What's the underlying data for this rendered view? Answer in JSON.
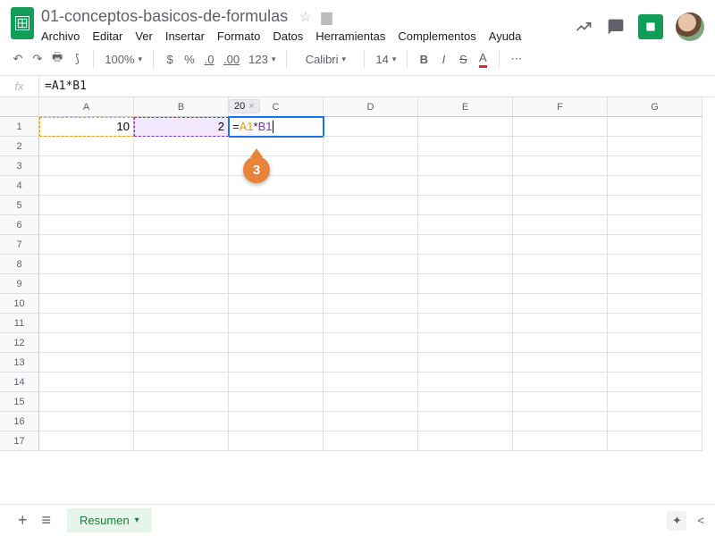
{
  "doc": {
    "title": "01-conceptos-basicos-de-formulas"
  },
  "menus": {
    "archivo": "Archivo",
    "editar": "Editar",
    "ver": "Ver",
    "insertar": "Insertar",
    "formato": "Formato",
    "datos": "Datos",
    "herramientas": "Herramientas",
    "complementos": "Complementos",
    "ayuda": "Ayuda"
  },
  "toolbar": {
    "zoom": "100%",
    "currency": "$",
    "percent": "%",
    "dec_dec": ".0",
    "inc_dec": ".00",
    "format": "123",
    "font": "Calibri",
    "size": "14",
    "bold": "B",
    "italic": "I",
    "strike": "S",
    "textcolor": "A",
    "more": "⋯"
  },
  "fx": {
    "label": "fx",
    "value": "=A1*B1"
  },
  "columns": [
    "A",
    "B",
    "C",
    "D",
    "E",
    "F",
    "G"
  ],
  "rows": [
    "1",
    "2",
    "3",
    "4",
    "5",
    "6",
    "7",
    "8",
    "9",
    "10",
    "11",
    "12",
    "13",
    "14",
    "15",
    "16",
    "17"
  ],
  "cells": {
    "A1": "10",
    "B1": "2",
    "C1": {
      "eq": "=",
      "ref1": "A1",
      "op": "*",
      "ref2": "B1"
    }
  },
  "tooltip": {
    "value": "20",
    "close": "×"
  },
  "callout": {
    "num": "3"
  },
  "footer": {
    "add": "+",
    "all": "≡",
    "sheet": "Resumen",
    "explore": "✦",
    "chevron": "<"
  }
}
